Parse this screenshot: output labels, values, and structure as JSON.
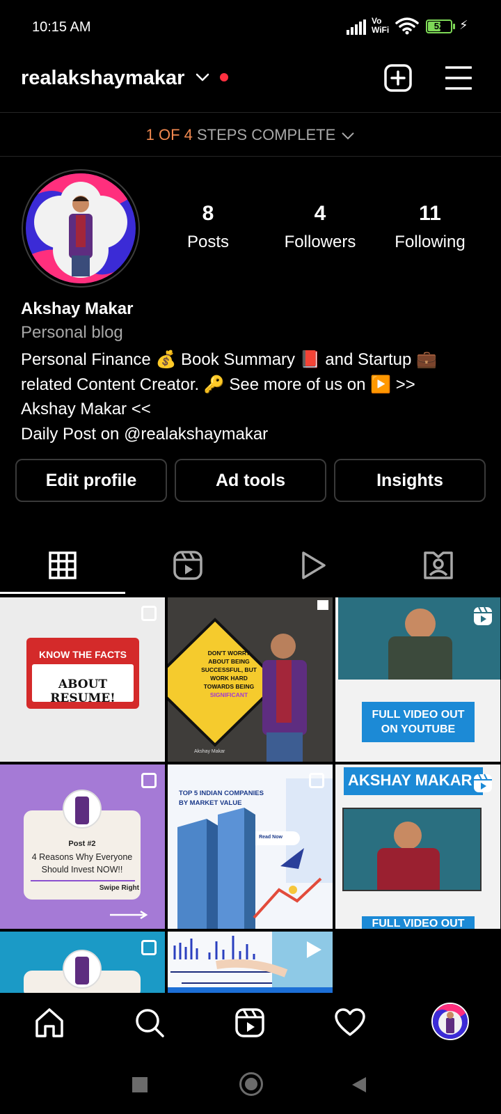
{
  "status_bar": {
    "time": "10:15 AM",
    "network": "Vo\nWiFi",
    "battery": "52",
    "battery_level": 0.52
  },
  "header": {
    "username": "realakshaymakar",
    "icons": [
      "chevron-down-icon",
      "notification-dot",
      "new-post-icon",
      "menu-icon"
    ]
  },
  "steps": {
    "progress": "1 OF 4",
    "label": " STEPS COMPLETE"
  },
  "profile": {
    "stats": [
      {
        "value": "8",
        "label": "Posts"
      },
      {
        "value": "4",
        "label": "Followers"
      },
      {
        "value": "11",
        "label": "Following"
      }
    ],
    "name": "Akshay Makar",
    "category": "Personal blog",
    "bio_lines": [
      "Personal Finance 💰 Book Summary 📕 and Startup 💼",
      "related Content Creator. 🔑 See more of us on ▶️ >>",
      "Akshay Makar <<",
      "Daily Post on @realakshaymakar"
    ]
  },
  "buttons": {
    "edit_profile": "Edit profile",
    "ad_tools": "Ad tools",
    "insights": "Insights"
  },
  "tabs": [
    "grid-icon",
    "reels-icon",
    "play-icon",
    "tagged-icon"
  ],
  "posts": [
    {
      "line1": "KNOW THE FACTS",
      "line2": "ABOUT RESUME!"
    },
    {
      "quote_lines": [
        "DON'T WORRY",
        "ABOUT BEING",
        "SUCCESSFUL, BUT",
        "WORK HARD",
        "TOWARDS BEING",
        "SIGNIFICANT"
      ],
      "author": "Akshay Makar"
    },
    {
      "caption_line1": "FULL VIDEO OUT",
      "caption_line2": "ON YOUTUBE"
    },
    {
      "post_num": "Post #2",
      "line1": "4 Reasons Why Everyone",
      "line2": "Should Invest NOW!!",
      "cta": "Swipe Right"
    },
    {
      "title_line1": "TOP 5 INDIAN COMPANIES",
      "title_line2": "BY MARKET VALUE",
      "cta": "Read Now"
    },
    {
      "banner": "AKSHAY MAKAR",
      "caption": "FULL VIDEO OUT"
    }
  ],
  "colors": {
    "accent_orange": "#f18950",
    "notification_red": "#ff3040",
    "battery_green": "#7ed957"
  }
}
